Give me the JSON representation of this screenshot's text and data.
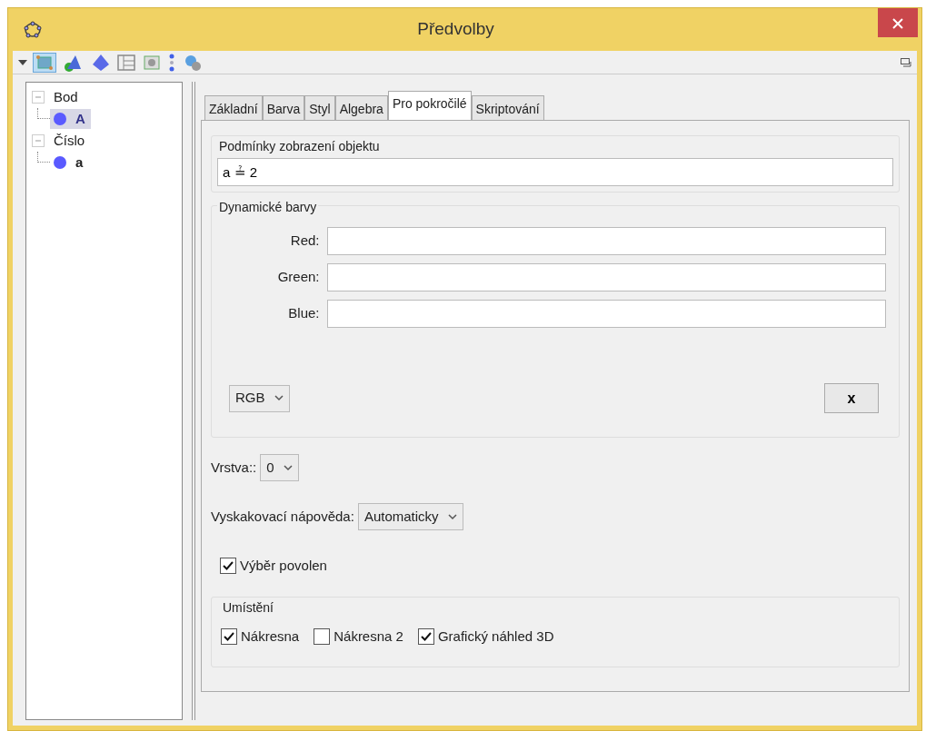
{
  "window": {
    "title": "Předvolby"
  },
  "tree": [
    {
      "label": "Bod",
      "expanded": true,
      "children": [
        {
          "label": "A",
          "selected": true
        }
      ]
    },
    {
      "label": "Číslo",
      "expanded": true,
      "children": [
        {
          "label": "a",
          "selected": false
        }
      ]
    }
  ],
  "tabs": [
    {
      "label": "Základní",
      "selected": false
    },
    {
      "label": "Barva",
      "selected": false
    },
    {
      "label": "Styl",
      "selected": false
    },
    {
      "label": "Algebra",
      "selected": false
    },
    {
      "label": "Pro pokročilé",
      "selected": true
    },
    {
      "label": "Skriptování",
      "selected": false
    }
  ],
  "condition": {
    "legend": "Podmínky zobrazení objektu",
    "value": "a ≟ 2"
  },
  "dynamic_colors": {
    "legend": "Dynamické barvy",
    "fields": [
      {
        "label": "Red:"
      },
      {
        "label": "Green:"
      },
      {
        "label": "Blue:"
      }
    ],
    "mode": "RGB",
    "clear_button": "x"
  },
  "layer": {
    "label": "Vrstva::",
    "value": "0"
  },
  "tooltip": {
    "label": "Vyskakovací nápověda:",
    "value": "Automaticky"
  },
  "selection_allowed": {
    "label": "Výběr povolen",
    "checked": true
  },
  "location": {
    "legend": "Umístění",
    "options": [
      {
        "label": "Nákresna",
        "checked": true
      },
      {
        "label": "Nákresna 2",
        "checked": false
      },
      {
        "label": "Grafický náhled 3D",
        "checked": true
      }
    ]
  }
}
